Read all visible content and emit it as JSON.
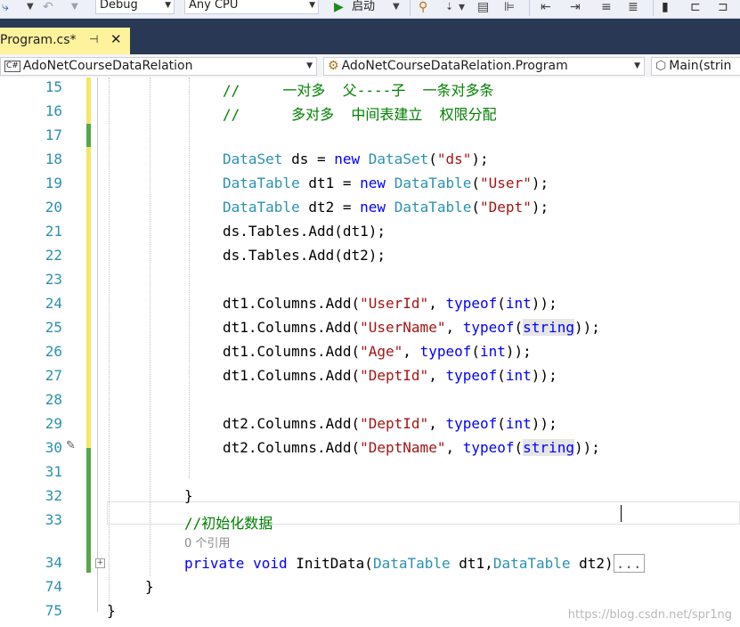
{
  "toolbar": {
    "config": "Debug",
    "platform": "Any CPU",
    "start_label": "启动"
  },
  "tab": {
    "title": "Program.cs*",
    "pin": "⊣",
    "close": "✕"
  },
  "navbar": {
    "project": "AdoNetCourseDataRelation",
    "project_icon": "C#",
    "type": "AdoNetCourseDataRelation.Program",
    "member": "Main(strin"
  },
  "lines": [
    {
      "n": "15",
      "text": "//     一对多  父----子  一条对多条"
    },
    {
      "n": "16",
      "text": "//      多对多  中间表建立  权限分配"
    },
    {
      "n": "17",
      "text": ""
    },
    {
      "n": "18",
      "text": "DataSet ds = new DataSet(\"ds\");"
    },
    {
      "n": "19",
      "text": "DataTable dt1 = new DataTable(\"User\");"
    },
    {
      "n": "20",
      "text": "DataTable dt2 = new DataTable(\"Dept\");"
    },
    {
      "n": "21",
      "text": "ds.Tables.Add(dt1);"
    },
    {
      "n": "22",
      "text": "ds.Tables.Add(dt2);"
    },
    {
      "n": "23",
      "text": ""
    },
    {
      "n": "24",
      "text": "dt1.Columns.Add(\"UserId\", typeof(int));"
    },
    {
      "n": "25",
      "text": "dt1.Columns.Add(\"UserName\", typeof(string));"
    },
    {
      "n": "26",
      "text": "dt1.Columns.Add(\"Age\", typeof(int));"
    },
    {
      "n": "27",
      "text": "dt1.Columns.Add(\"DeptId\", typeof(int));"
    },
    {
      "n": "28",
      "text": ""
    },
    {
      "n": "29",
      "text": "dt2.Columns.Add(\"DeptId\", typeof(int));"
    },
    {
      "n": "30",
      "text": "dt2.Columns.Add(\"DeptName\", typeof(string));"
    },
    {
      "n": "31",
      "text": ""
    },
    {
      "n": "32",
      "text": "}"
    },
    {
      "n": "33",
      "text": "//初始化数据"
    },
    {
      "n": "34",
      "text": "private void InitData(DataTable dt1,DataTable dt2)..."
    },
    {
      "n": "74",
      "text": "}"
    },
    {
      "n": "75",
      "text": "}"
    }
  ],
  "codelens": "0 个引用",
  "collapsed_marker": "...",
  "watermark": "https://blog.csdn.net/spr1ng",
  "colors": {
    "type": "#2b91af",
    "keyword": "#0000ff",
    "string": "#a31515",
    "comment": "#008000",
    "changed_unsaved": "#f5e664",
    "changed_saved": "#57a64a"
  }
}
